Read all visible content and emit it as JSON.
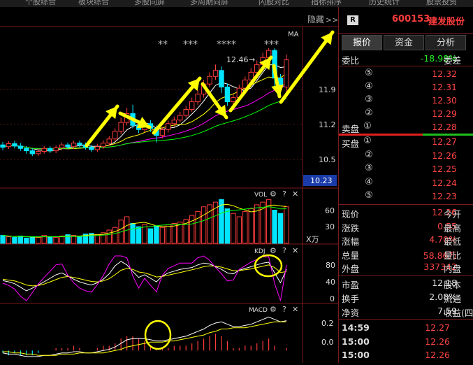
{
  "top_nav": [
    "个股综合",
    "板块综合",
    "多股同屏",
    "多周期同屏",
    "闪股对比",
    "指标排序",
    "历史统计",
    "股票投资"
  ],
  "chart": {
    "hide_label": "隐藏",
    "hide_icon": "double-chevron-right-icon",
    "ma_label": "MA",
    "price_high_label": "12.46",
    "price_ticks": [
      "11.9",
      "11.2",
      "10.5"
    ],
    "current_price_tag": "10.23",
    "star_groups": [
      "**",
      "***",
      "****",
      "***"
    ],
    "vol_label": "VOL",
    "vol_ticks": [
      "60",
      "30"
    ],
    "vol_unit": "X万",
    "kdj_label": "KDJ",
    "kdj_ticks": [
      "80",
      "40",
      "0"
    ],
    "macd_label": "MACD",
    "macd_ticks": [
      "0.2",
      "0.0"
    ],
    "panel_icons": [
      "gear-icon",
      "help-icon",
      "close-icon"
    ],
    "panel_icon_glyphs": [
      "⚙",
      "?",
      "✕"
    ]
  },
  "chart_data": {
    "type": "candlestick",
    "candles": [
      {
        "o": 10.82,
        "c": 10.78,
        "h": 10.87,
        "l": 10.73
      },
      {
        "o": 10.79,
        "c": 10.84,
        "h": 10.88,
        "l": 10.75
      },
      {
        "o": 10.84,
        "c": 10.8,
        "h": 10.89,
        "l": 10.76
      },
      {
        "o": 10.8,
        "c": 10.76,
        "h": 10.85,
        "l": 10.72
      },
      {
        "o": 10.76,
        "c": 10.72,
        "h": 10.8,
        "l": 10.67
      },
      {
        "o": 10.72,
        "c": 10.67,
        "h": 10.76,
        "l": 10.63
      },
      {
        "o": 10.67,
        "c": 10.71,
        "h": 10.75,
        "l": 10.63
      },
      {
        "o": 10.71,
        "c": 10.76,
        "h": 10.8,
        "l": 10.67
      },
      {
        "o": 10.76,
        "c": 10.72,
        "h": 10.8,
        "l": 10.68
      },
      {
        "o": 10.72,
        "c": 10.77,
        "h": 10.81,
        "l": 10.68
      },
      {
        "o": 10.77,
        "c": 10.82,
        "h": 10.86,
        "l": 10.73
      },
      {
        "o": 10.82,
        "c": 10.79,
        "h": 10.86,
        "l": 10.75
      },
      {
        "o": 10.79,
        "c": 10.85,
        "h": 10.89,
        "l": 10.75
      },
      {
        "o": 10.85,
        "c": 10.82,
        "h": 10.89,
        "l": 10.78
      },
      {
        "o": 10.82,
        "c": 10.78,
        "h": 10.86,
        "l": 10.74
      },
      {
        "o": 10.78,
        "c": 10.74,
        "h": 10.82,
        "l": 10.7
      },
      {
        "o": 10.74,
        "c": 10.79,
        "h": 10.84,
        "l": 10.7
      },
      {
        "o": 10.79,
        "c": 10.85,
        "h": 10.9,
        "l": 10.75
      },
      {
        "o": 10.85,
        "c": 10.92,
        "h": 10.97,
        "l": 10.81
      },
      {
        "o": 10.92,
        "c": 11.05,
        "h": 11.1,
        "l": 10.88
      },
      {
        "o": 11.05,
        "c": 11.2,
        "h": 11.28,
        "l": 11.0
      },
      {
        "o": 11.2,
        "c": 11.35,
        "h": 11.45,
        "l": 11.15
      },
      {
        "o": 11.35,
        "c": 11.15,
        "h": 11.5,
        "l": 11.1
      },
      {
        "o": 11.15,
        "c": 11.08,
        "h": 11.22,
        "l": 11.02
      },
      {
        "o": 11.08,
        "c": 11.18,
        "h": 11.24,
        "l": 11.03
      },
      {
        "o": 11.18,
        "c": 11.1,
        "h": 11.24,
        "l": 11.04
      },
      {
        "o": 11.1,
        "c": 10.98,
        "h": 11.15,
        "l": 10.86
      },
      {
        "o": 10.98,
        "c": 11.08,
        "h": 11.12,
        "l": 10.93
      },
      {
        "o": 11.08,
        "c": 11.18,
        "h": 11.23,
        "l": 11.03
      },
      {
        "o": 11.18,
        "c": 11.24,
        "h": 11.3,
        "l": 11.13
      },
      {
        "o": 11.24,
        "c": 11.32,
        "h": 11.38,
        "l": 11.2
      },
      {
        "o": 11.32,
        "c": 11.42,
        "h": 11.48,
        "l": 11.28
      },
      {
        "o": 11.42,
        "c": 11.55,
        "h": 11.62,
        "l": 11.38
      },
      {
        "o": 11.55,
        "c": 11.68,
        "h": 11.75,
        "l": 11.5
      },
      {
        "o": 11.68,
        "c": 11.85,
        "h": 11.92,
        "l": 11.62
      },
      {
        "o": 11.85,
        "c": 11.98,
        "h": 12.05,
        "l": 11.8
      },
      {
        "o": 11.98,
        "c": 12.08,
        "h": 12.18,
        "l": 11.92
      },
      {
        "o": 12.08,
        "c": 11.8,
        "h": 12.15,
        "l": 11.7
      },
      {
        "o": 11.8,
        "c": 11.55,
        "h": 11.86,
        "l": 11.48
      },
      {
        "o": 11.55,
        "c": 11.62,
        "h": 11.68,
        "l": 11.48
      },
      {
        "o": 11.62,
        "c": 11.78,
        "h": 11.84,
        "l": 11.56
      },
      {
        "o": 11.78,
        "c": 11.92,
        "h": 11.98,
        "l": 11.72
      },
      {
        "o": 11.92,
        "c": 12.05,
        "h": 12.12,
        "l": 11.86
      },
      {
        "o": 12.05,
        "c": 12.18,
        "h": 12.25,
        "l": 12.0
      },
      {
        "o": 12.18,
        "c": 12.3,
        "h": 12.38,
        "l": 12.1
      },
      {
        "o": 12.3,
        "c": 12.42,
        "h": 12.46,
        "l": 12.22
      },
      {
        "o": 12.42,
        "c": 11.95,
        "h": 12.46,
        "l": 11.8
      },
      {
        "o": 11.95,
        "c": 11.8,
        "h": 12.02,
        "l": 11.68
      },
      {
        "o": 11.8,
        "c": 12.26,
        "h": 12.35,
        "l": 11.72
      }
    ],
    "volume": [
      12,
      10,
      9,
      11,
      8,
      10,
      9,
      12,
      10,
      9,
      11,
      13,
      12,
      10,
      14,
      15,
      13,
      16,
      20,
      24,
      35,
      40,
      30,
      25,
      28,
      22,
      26,
      24,
      28,
      30,
      32,
      36,
      42,
      48,
      55,
      58,
      62,
      66,
      52,
      45,
      40,
      48,
      52,
      58,
      62,
      66,
      50,
      45,
      55
    ],
    "kdj": {
      "k": [
        45,
        42,
        38,
        30,
        22,
        28,
        35,
        42,
        50,
        58,
        62,
        55,
        48,
        42,
        38,
        35,
        40,
        48,
        60,
        78,
        88,
        80,
        65,
        52,
        58,
        50,
        42,
        55,
        62,
        66,
        70,
        72,
        74,
        80,
        84,
        82,
        76,
        70,
        62,
        60,
        68,
        72,
        76,
        80,
        84,
        86,
        62,
        40,
        70
      ],
      "d": [
        48,
        46,
        44,
        40,
        35,
        33,
        34,
        37,
        42,
        47,
        52,
        54,
        52,
        49,
        46,
        43,
        42,
        44,
        49,
        58,
        68,
        72,
        70,
        64,
        62,
        58,
        53,
        54,
        57,
        60,
        63,
        66,
        69,
        72,
        76,
        78,
        77,
        75,
        71,
        67,
        67,
        69,
        71,
        74,
        77,
        80,
        74,
        63,
        65
      ],
      "j": [
        39,
        34,
        26,
        10,
        0,
        18,
        37,
        52,
        66,
        80,
        82,
        57,
        40,
        28,
        22,
        19,
        36,
        56,
        82,
        100,
        100,
        96,
        55,
        28,
        50,
        34,
        20,
        57,
        72,
        78,
        84,
        84,
        84,
        96,
        100,
        90,
        74,
        60,
        44,
        46,
        70,
        78,
        86,
        92,
        98,
        98,
        38,
        0,
        80
      ]
    },
    "macd": {
      "dif": [
        -0.02,
        -0.03,
        -0.03,
        -0.04,
        -0.05,
        -0.05,
        -0.05,
        -0.04,
        -0.04,
        -0.03,
        -0.02,
        -0.02,
        -0.01,
        -0.01,
        -0.02,
        -0.02,
        -0.01,
        0.0,
        0.01,
        0.03,
        0.06,
        0.09,
        0.1,
        0.1,
        0.1,
        0.09,
        0.08,
        0.08,
        0.09,
        0.1,
        0.11,
        0.12,
        0.14,
        0.16,
        0.18,
        0.21,
        0.23,
        0.24,
        0.22,
        0.2,
        0.2,
        0.21,
        0.22,
        0.24,
        0.26,
        0.28,
        0.26,
        0.24,
        0.25
      ],
      "dea": [
        -0.01,
        -0.01,
        -0.02,
        -0.02,
        -0.03,
        -0.03,
        -0.04,
        -0.04,
        -0.04,
        -0.04,
        -0.03,
        -0.03,
        -0.03,
        -0.02,
        -0.02,
        -0.02,
        -0.02,
        -0.02,
        -0.01,
        0.0,
        0.01,
        0.03,
        0.04,
        0.05,
        0.06,
        0.07,
        0.07,
        0.07,
        0.08,
        0.08,
        0.09,
        0.1,
        0.11,
        0.12,
        0.13,
        0.15,
        0.16,
        0.18,
        0.18,
        0.19,
        0.19,
        0.19,
        0.2,
        0.21,
        0.22,
        0.23,
        0.24,
        0.24,
        0.24
      ]
    },
    "ylim_price": [
      10.1,
      12.8
    ],
    "ylim_vol": [
      0,
      80
    ],
    "ylim_kdj": [
      0,
      100
    ],
    "ylim_macd": [
      -0.08,
      0.3
    ]
  },
  "quote": {
    "r_badge": "R",
    "code": "600153",
    "name": "建发股份",
    "tabs": [
      "报价",
      "资金",
      "分析"
    ],
    "weibi_label": "委比",
    "weibi_value": "-18.98%",
    "weicha_label": "委差",
    "sell_label": "卖盘",
    "buy_label": "买盘",
    "sells": [
      {
        "n": "⑤",
        "p": "12.32"
      },
      {
        "n": "④",
        "p": "12.31"
      },
      {
        "n": "③",
        "p": "12.30"
      },
      {
        "n": "②",
        "p": "12.29"
      },
      {
        "n": "①",
        "p": "12.28"
      }
    ],
    "buys": [
      {
        "n": "①",
        "p": "12.27"
      },
      {
        "n": "②",
        "p": "12.26"
      },
      {
        "n": "③",
        "p": "12.25"
      },
      {
        "n": "④",
        "p": "12.24"
      },
      {
        "n": "⑤",
        "p": "12.23"
      }
    ],
    "stats": [
      {
        "l": "现价",
        "v": "12.26",
        "r": "今开"
      },
      {
        "l": "涨跌",
        "v": "0.55",
        "r": "最高"
      },
      {
        "l": "涨幅",
        "v": "4.70%",
        "r": "最低"
      },
      {
        "l": "总量",
        "v": "58.86万",
        "r": "量比"
      },
      {
        "l": "外盘",
        "v": "337342",
        "r": "内盘"
      }
    ],
    "stats2": [
      {
        "l": "市盈",
        "v": "12.18",
        "r": "股本"
      },
      {
        "l": "换手",
        "v": "2.08%",
        "r": "流通"
      },
      {
        "l": "净资",
        "v": "7.59",
        "r": "收益(四"
      }
    ],
    "ticks": [
      {
        "t": "14:59",
        "p": "12.27"
      },
      {
        "t": "15:00",
        "p": "12.26"
      },
      {
        "t": "15:00",
        "p": "12.26"
      }
    ]
  },
  "colors": {
    "up": "#ff3c3c",
    "down": "#00e5ff",
    "ma_white": "#ffffff",
    "ma_yellow": "#ffff00",
    "ma_magenta": "#ff00ff",
    "ma_green": "#00ff00",
    "annotation": "#ffff00",
    "quote_red": "#ff4444",
    "quote_green": "#22ee22"
  }
}
